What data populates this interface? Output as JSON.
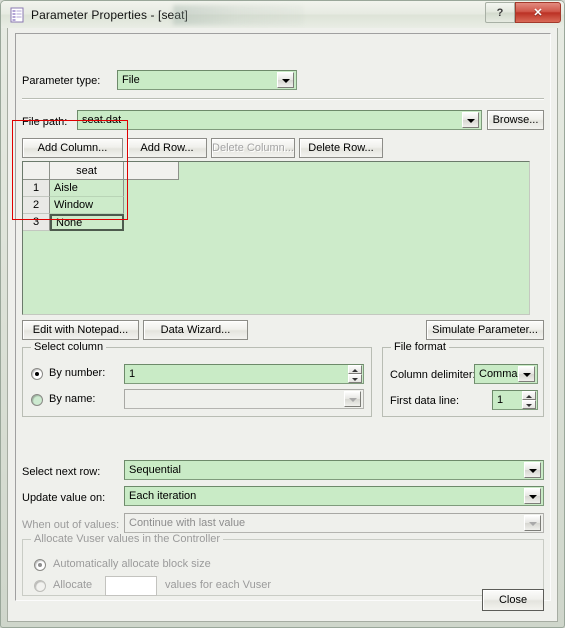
{
  "window": {
    "title": "Parameter Properties - [seat]",
    "icon": "document-grid-icon",
    "help_label": "?",
    "close_label": "✕"
  },
  "parameter_type": {
    "label": "Parameter type:",
    "value": "File"
  },
  "file_path": {
    "label": "File path:",
    "value": "seat.dat",
    "browse_label": "Browse..."
  },
  "grid_toolbar": {
    "add_column": "Add Column...",
    "add_row": "Add Row...",
    "delete_column": "Delete Column...",
    "delete_row": "Delete Row..."
  },
  "grid": {
    "columns": [
      "seat",
      ""
    ],
    "row_numbers": [
      "1",
      "2",
      "3"
    ],
    "rows": [
      {
        "seat": "Aisle"
      },
      {
        "seat": "Window"
      },
      {
        "seat": "None"
      }
    ],
    "selected_cell": "None"
  },
  "grid_buttons": {
    "edit_with_notepad": "Edit with Notepad...",
    "data_wizard": "Data Wizard...",
    "simulate_parameter": "Simulate Parameter..."
  },
  "select_column": {
    "title": "Select column",
    "by_number_label": "By number:",
    "by_number_value": "1",
    "by_number_selected": true,
    "by_name_label": "By name:",
    "by_name_value": "",
    "by_name_selected": false
  },
  "file_format": {
    "title": "File format",
    "column_delimiter_label": "Column delimiter:",
    "column_delimiter_value": "Comma",
    "first_data_line_label": "First data line:",
    "first_data_line_value": "1"
  },
  "row_options": {
    "select_next_row_label": "Select next row:",
    "select_next_row_value": "Sequential",
    "update_value_on_label": "Update value on:",
    "update_value_on_value": "Each iteration",
    "when_out_of_values_label": "When out of values:",
    "when_out_of_values_value": "Continue with last value"
  },
  "allocate": {
    "title": "Allocate Vuser values in the Controller",
    "auto_label": "Automatically allocate block size",
    "auto_selected": true,
    "allocate_label": "Allocate",
    "allocate_value": "",
    "allocate_suffix": "values for each Vuser"
  },
  "footer": {
    "close_label": "Close"
  },
  "colors": {
    "field_green": "#c9ebc6",
    "grid_green": "#cdebca",
    "annotation_red": "#e00000",
    "close_button_red": "#bb3124"
  }
}
